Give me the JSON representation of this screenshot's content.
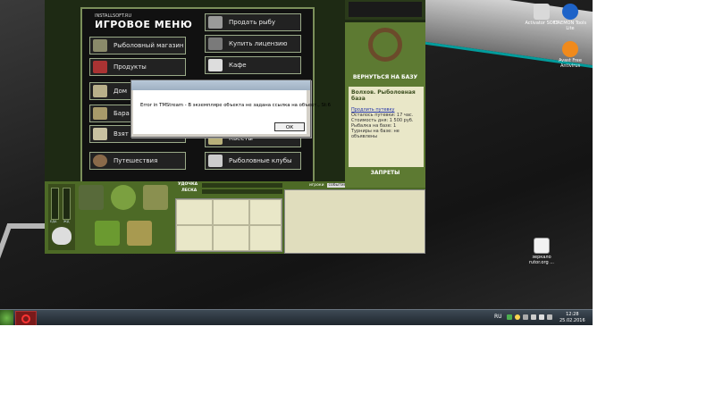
{
  "game": {
    "site": "INSTALLSOFT.RU",
    "menu_title": "ИГРОВОЕ МЕНЮ",
    "menu_left": [
      {
        "label": "Рыболовный магазин",
        "icon": "reel-icon"
      },
      {
        "label": "Продукты",
        "icon": "food-icon"
      },
      {
        "label": "Дом",
        "icon": "house-icon"
      },
      {
        "label": "Бара",
        "icon": "bar-icon"
      },
      {
        "label": "Взят",
        "icon": "take-icon"
      },
      {
        "label": "Путешествия",
        "icon": "wheel-icon"
      }
    ],
    "menu_right": [
      {
        "label": "Продать рыбу",
        "icon": "fish-icon"
      },
      {
        "label": "Купить лицензию",
        "icon": "license-icon"
      },
      {
        "label": "Кафе",
        "icon": "cafe-icon"
      },
      {
        "label": "",
        "icon": "blank-icon"
      },
      {
        "label": "",
        "icon": "blank-icon"
      },
      {
        "label": "Квесты",
        "icon": "quest-icon"
      },
      {
        "label": "Рыболовные клубы",
        "icon": "club-icon"
      }
    ],
    "base_button": "ВЕРНУТЬСЯ НА БАЗУ",
    "base_title": "Волхов. Рыболовная база",
    "extend_link": "Продлить путевку",
    "base_info": [
      "Осталось путевки: 17 час.",
      "Стоимость дня: 1 500 руб.",
      "Рыбалка на базе: 1",
      "Турниры на базе: не объявлены"
    ],
    "ban_button": "ЗАПРЕТЫ",
    "rod_label": "УДОЧКА",
    "line_label": "ЛЕСКА",
    "players_label": "игроки",
    "players_tab": "события",
    "gauge_labels": [
      "ЕДА",
      "ЖД"
    ]
  },
  "dialog": {
    "title": "",
    "message": "Error in TMStream - В экземпляре объекта не задана ссылка на объект., St:6",
    "ok": "ОК"
  },
  "desktop_icons": [
    {
      "label": "Activator SOFT",
      "color": "#d9d9d9"
    },
    {
      "label": "DAEMON Tools Lite",
      "color": "#1e63c8"
    },
    {
      "label": "Avast Free Antivirus",
      "color": "#f08a1c"
    },
    {
      "label": "зеркало rutor.org ...",
      "color": "#f2f2f2"
    }
  ],
  "tray": {
    "lang": "RU",
    "time": "12:28",
    "date": "25.02.2016"
  }
}
